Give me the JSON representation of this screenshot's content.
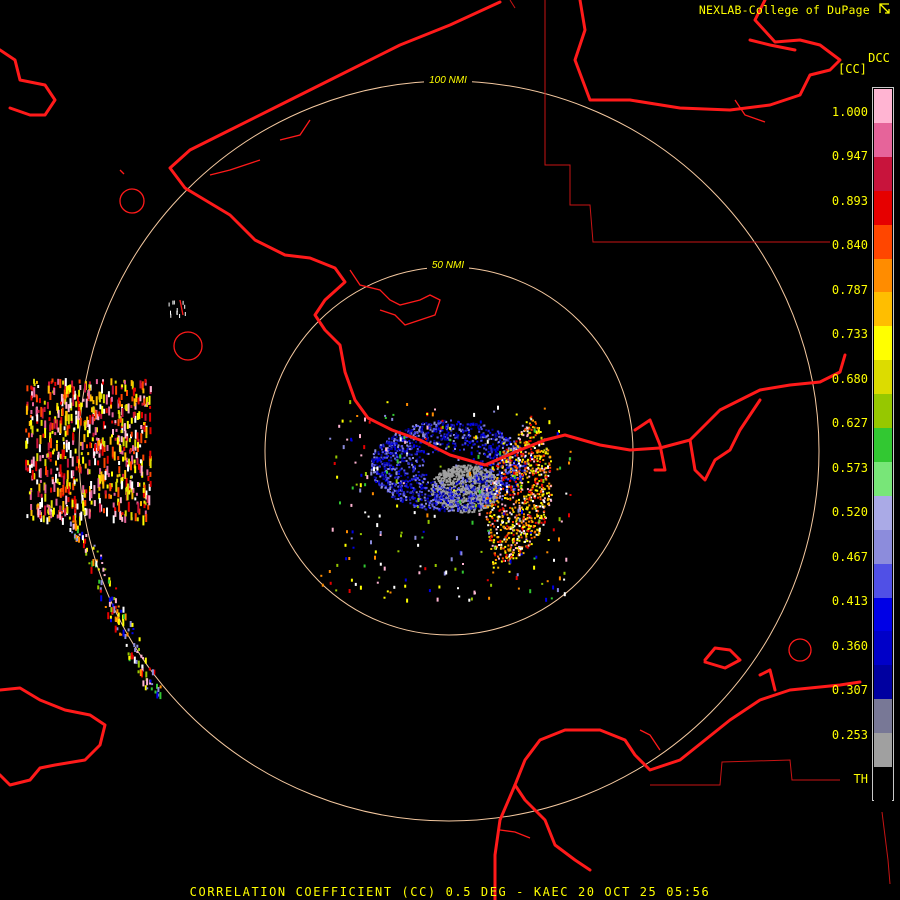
{
  "header": {
    "credit": "NEXLAB-College of DuPage",
    "credit_logo_icon": "cod-logo-icon",
    "product_code": "DCC",
    "units": "[CC]"
  },
  "rings": [
    {
      "label": "100 NMI",
      "range_nmi": 100
    },
    {
      "label": "50 NMI",
      "range_nmi": 50
    }
  ],
  "colorbar": {
    "ticks": [
      "1.000",
      "0.947",
      "0.893",
      "0.840",
      "0.787",
      "0.733",
      "0.680",
      "0.627",
      "0.573",
      "0.520",
      "0.467",
      "0.413",
      "0.360",
      "0.307",
      "0.253",
      "TH"
    ],
    "colors": [
      "#ffb4d2",
      "#e6649a",
      "#c8143c",
      "#e60000",
      "#ff4600",
      "#ff8c00",
      "#ffbe00",
      "#ffff00",
      "#dcdc00",
      "#96c800",
      "#32c832",
      "#78e678",
      "#aaaae6",
      "#8c8cdc",
      "#5050e6",
      "#0000e6",
      "#0000c8",
      "#0000a0",
      "#787896",
      "#a0a0a0",
      "#000000"
    ]
  },
  "footer": {
    "title": "CORRELATION COEFFICIENT (CC) 0.5 DEG - KAEC 20 OCT 25 05:56"
  },
  "palette": {
    "text": "#ffff00",
    "coastline": "#ff1a1a",
    "range_ring": "#f5c9a0",
    "background": "#000000"
  }
}
